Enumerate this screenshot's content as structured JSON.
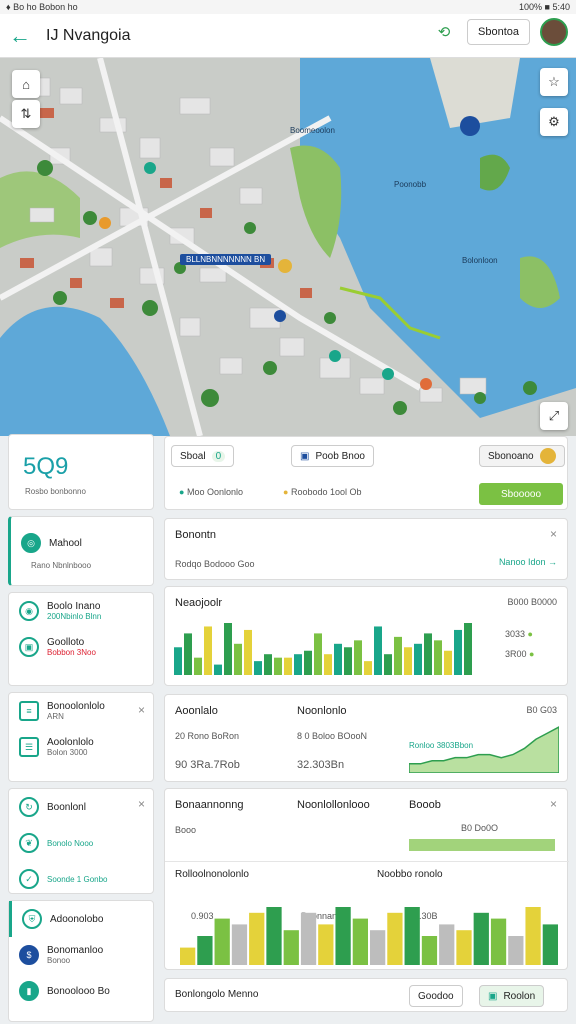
{
  "status": {
    "left": "♦ Bo ho Bobon ho",
    "right": "100% ■ 5:40"
  },
  "appbar": {
    "back_icon": "back-arrow-icon",
    "title": "IJ Nvangoia",
    "button": "Sbontoa"
  },
  "map": {
    "label_bay": "Poonobb",
    "label_mid": "Boomeoolon",
    "label_east": "Bolonloon",
    "chip": "BLLNBNNNNNNN BN"
  },
  "sidebar": {
    "stat_value": "5Q9",
    "stat_label": "Rosbo bonbonno",
    "active_title": "Mahool",
    "active_sub": "Rano Nbnlnbooo",
    "items": [
      {
        "title": "Boolo Inano",
        "sub": "200Nbinlo Blnn"
      },
      {
        "title": "Goolloto",
        "sub": "Bobbon 3Noo"
      },
      {
        "title": "Bonoolonlolo",
        "sub": "ARN"
      },
      {
        "title": "Aoolonlolo",
        "sub": "Bolon 3000"
      },
      {
        "title": "Boonlonl",
        "sub": ""
      },
      {
        "title": "Bonolo Nooo",
        "sub": ""
      },
      {
        "title": "Soonde 1 Gonbo",
        "sub": ""
      },
      {
        "title": "Adoonolobo",
        "sub": ""
      },
      {
        "title": "Bonomanloo",
        "sub": "Bonoo"
      },
      {
        "title": "Bonoolooo Bo",
        "sub": ""
      }
    ]
  },
  "filters": {
    "chip_a": "Sboal",
    "chip_a_badge": "0",
    "chip_b": "Poob Bnoo",
    "chip_c": "Sbonoano",
    "info_a": "Moo Oonlonlo",
    "info_b": "Roobodo 1ool Ob",
    "action": "Sbooooo"
  },
  "panel_header": {
    "title": "Bonontn",
    "sub": "Rodqo Bodooo Goo",
    "link": "Nanoo Idon"
  },
  "chart1": {
    "title": "Neaojoolr",
    "tag": "B000 B0000",
    "legend_a": "3033",
    "legend_b": "3R00"
  },
  "stats": {
    "title_a": "Aoonlalo",
    "title_b": "Noonlonlo",
    "tag": "B0 G03",
    "row_a": "20 Rono BoRon",
    "row_b": "8 0 Boloo BOooN",
    "val_a": "90 3Ra.7Rob",
    "val_b": "32.303Bn",
    "chart_tag": "Ronloo 3803Bbon"
  },
  "chart2": {
    "title_a": "Bonaannonng",
    "title_b": "Noonlollonlooo",
    "title_c": "Booob",
    "row": "Booo",
    "tag": "B0 Do0O"
  },
  "chart3": {
    "title_a": "Rolloolnonolonlo",
    "title_b": "Noobbo ronolo",
    "label_a": "0.903",
    "label_b": "Boonnan",
    "label_c": "B.30B"
  },
  "footer": {
    "title": "Bonlongolo Menno",
    "btn_a": "Goodoo",
    "btn_b": "Roolon"
  },
  "chart_data": [
    {
      "type": "bar",
      "values": [
        8,
        12,
        5,
        14,
        3,
        15,
        9,
        13,
        4,
        6,
        5,
        5,
        6,
        7,
        12,
        6,
        9,
        8,
        10,
        4,
        14,
        6,
        11,
        8,
        9,
        12,
        10,
        7,
        13,
        15
      ]
    },
    {
      "type": "area",
      "values": [
        3,
        3,
        4,
        4,
        5,
        5,
        6,
        6,
        5,
        6,
        8,
        11,
        13,
        15
      ]
    },
    {
      "type": "bar",
      "values": [
        3,
        5,
        8,
        7,
        9,
        10,
        6,
        9,
        7,
        10,
        8,
        6,
        9,
        10,
        5,
        7,
        6,
        9,
        8,
        5,
        10,
        7
      ]
    }
  ]
}
